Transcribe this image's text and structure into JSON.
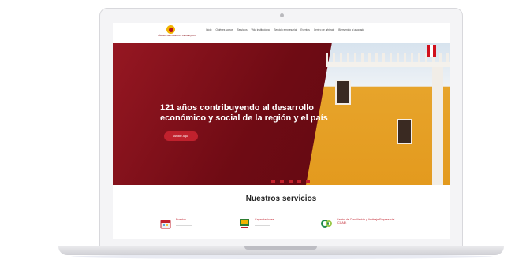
{
  "header": {
    "logo_text": "CÁMARA DE COMERCIO DE AREQUIPA",
    "nav": [
      "Inicio",
      "Quiénes somos",
      "Servicios",
      "Vida institucional",
      "Servicio empresarial",
      "Eventos",
      "Centro de arbitraje",
      "Bienvenido al asociado"
    ]
  },
  "hero": {
    "title": "121 años contribuyendo al desarrollo económico y social de la región y el país",
    "button": "Afiliate Aquí",
    "slides": 5,
    "active_dot": 0
  },
  "services": {
    "title": "Nuestros servicios",
    "items": [
      {
        "label": "Eventos",
        "icon": "calendar-icon"
      },
      {
        "label": "Capacitaciones",
        "icon": "training-icon"
      },
      {
        "label": "Centro de Conciliación y Arbitraje Empresarial (CCAE)",
        "icon": "ccae-logo-icon"
      }
    ]
  },
  "colors": {
    "brand": "#7e0d16",
    "accent": "#c0212d"
  }
}
